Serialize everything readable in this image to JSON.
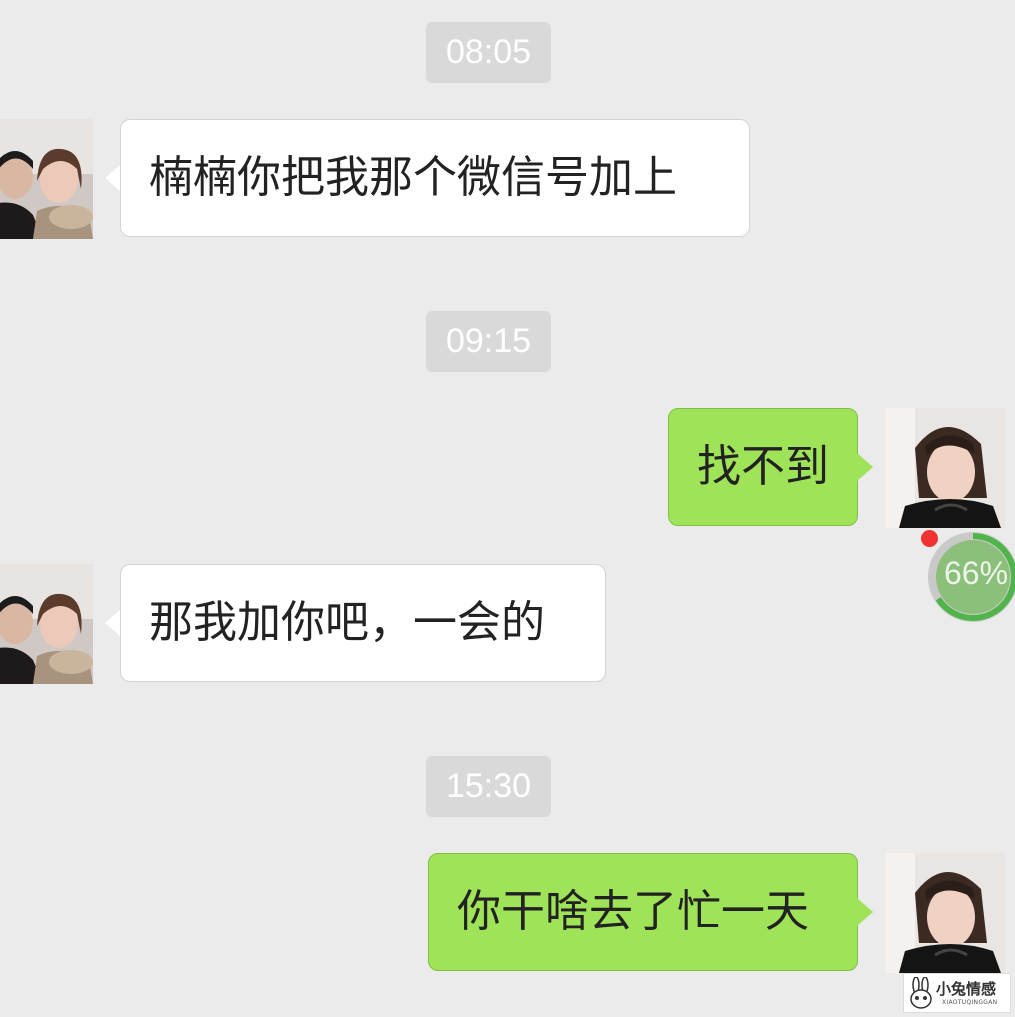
{
  "timestamps": [
    "08:05",
    "09:15",
    "15:30"
  ],
  "messages": [
    {
      "direction": "incoming",
      "text": "楠楠你把我那个微信号加上"
    },
    {
      "direction": "outgoing",
      "text": "找不到"
    },
    {
      "direction": "incoming",
      "text": "那我加你吧，一会的"
    },
    {
      "direction": "outgoing",
      "text": "你干啥去了忙一天"
    }
  ],
  "upload": {
    "progress_label": "66%",
    "progress": 0.66
  },
  "watermark": {
    "title": "小兔情感",
    "subtitle": "XIAOTUQINGGAN"
  },
  "colors": {
    "background": "#ebebeb",
    "outgoing_bubble": "#9fe358",
    "incoming_bubble": "#ffffff",
    "timestamp_pill": "#d9d9d9",
    "unread_dot": "#f03232"
  },
  "icons": [
    "contact-avatar",
    "self-avatar",
    "upload-progress-ring",
    "unread-dot",
    "rabbit-logo-icon"
  ]
}
